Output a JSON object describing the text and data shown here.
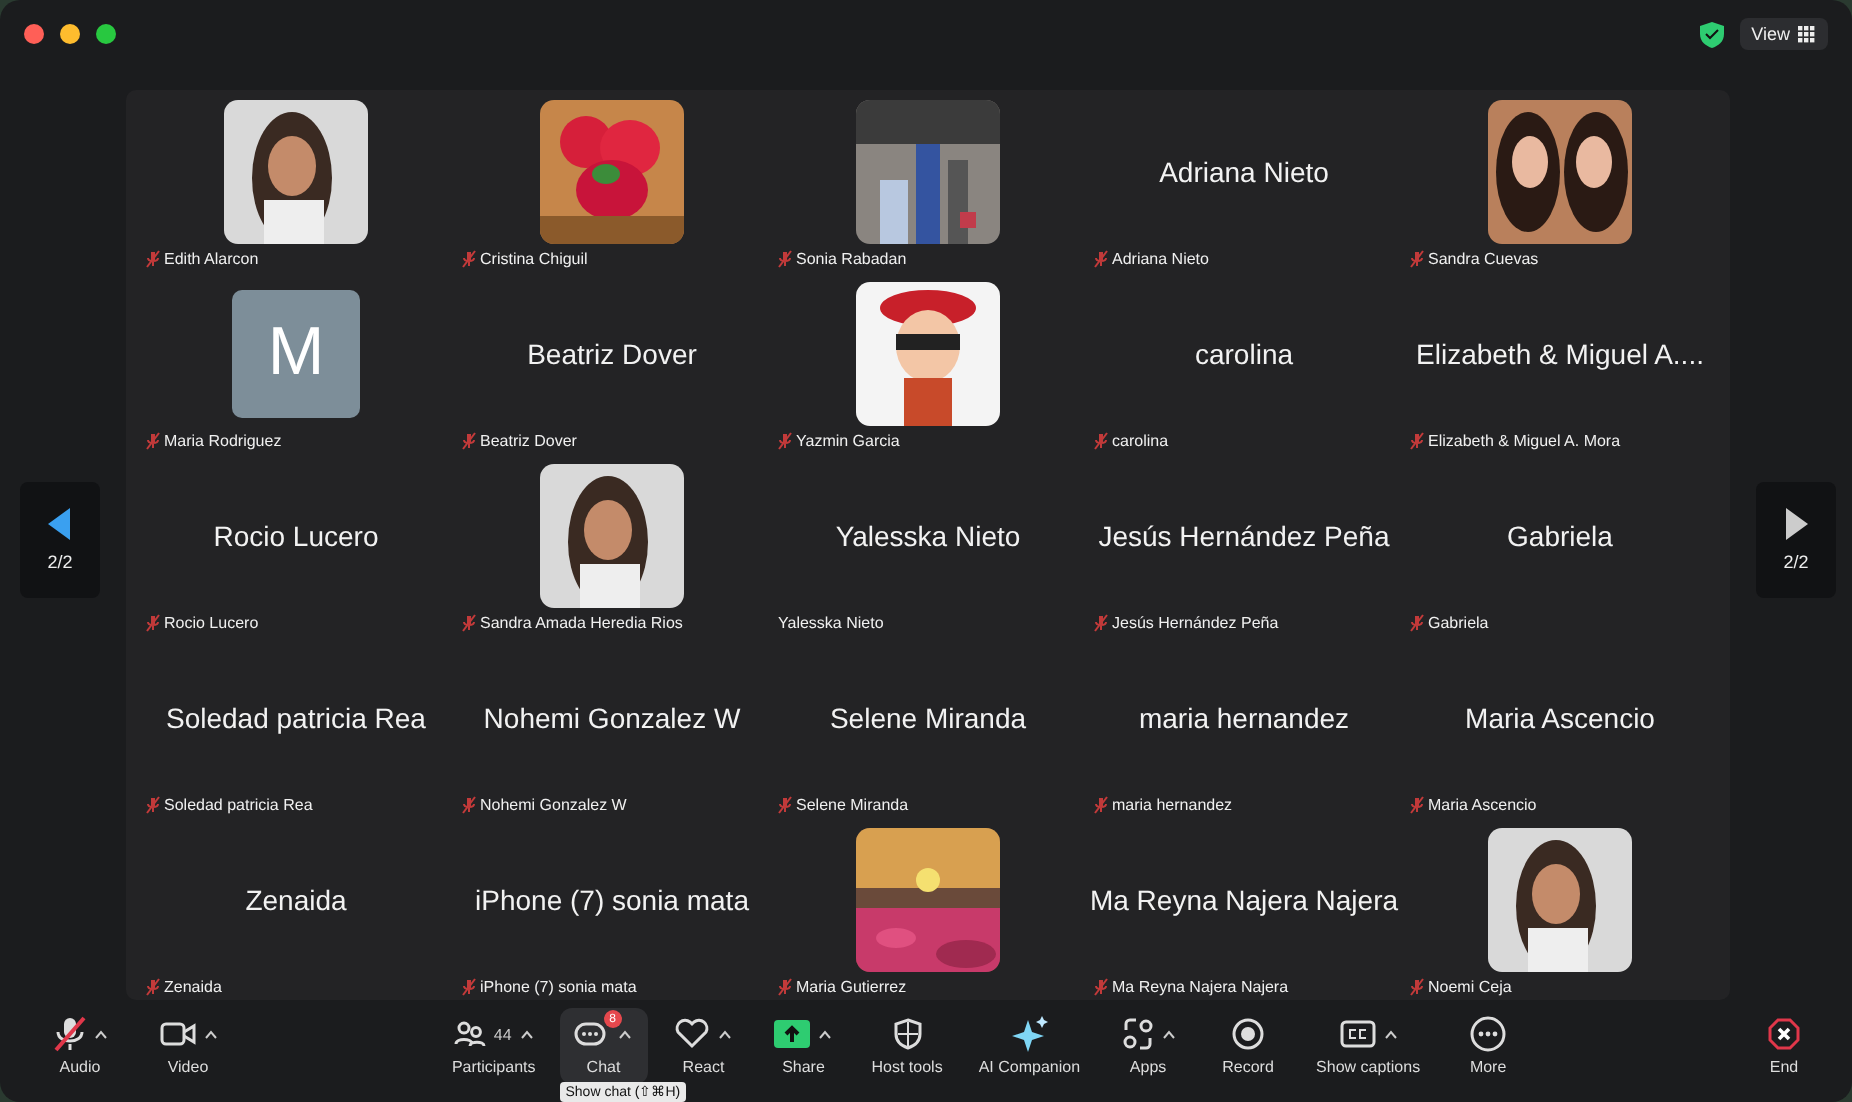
{
  "top_bar": {
    "view_label": "View"
  },
  "pager": {
    "previous_label": "2/2",
    "next_label": "2/2"
  },
  "tiles": [
    {
      "kind": "picture",
      "name": "Edith Alarcon",
      "muted": true
    },
    {
      "kind": "picture",
      "name": "Cristina Chiguil",
      "muted": true
    },
    {
      "kind": "picture",
      "name": "Sonia Rabadan",
      "muted": true
    },
    {
      "kind": "name",
      "display": "Adriana Nieto",
      "name": "Adriana Nieto",
      "muted": true
    },
    {
      "kind": "picture",
      "name": "Sandra Cuevas",
      "muted": true
    },
    {
      "kind": "initial",
      "display": "M",
      "name": "Maria Rodriguez",
      "muted": true
    },
    {
      "kind": "name",
      "display": "Beatriz Dover",
      "name": "Beatriz Dover",
      "muted": true
    },
    {
      "kind": "picture",
      "name": "Yazmin Garcia",
      "muted": true
    },
    {
      "kind": "name",
      "display": "carolina",
      "name": "carolina",
      "muted": true
    },
    {
      "kind": "name",
      "display": "Elizabeth & Miguel A....",
      "name": "Elizabeth & Miguel A.  Mora",
      "muted": true
    },
    {
      "kind": "name",
      "display": "Rocio Lucero",
      "name": "Rocio Lucero",
      "muted": true
    },
    {
      "kind": "picture",
      "name": "Sandra Amada Heredia Rios",
      "muted": true
    },
    {
      "kind": "name",
      "display": "Yalesska Nieto",
      "name": "Yalesska Nieto",
      "muted": false
    },
    {
      "kind": "name",
      "display": "Jesús Hernández Peña",
      "name": "Jesús Hernández Peña",
      "muted": true
    },
    {
      "kind": "name",
      "display": "Gabriela",
      "name": "Gabriela",
      "muted": true
    },
    {
      "kind": "name",
      "display": "Soledad patricia Rea",
      "name": "Soledad patricia Rea",
      "muted": true
    },
    {
      "kind": "name",
      "display": "Nohemi Gonzalez W",
      "name": "Nohemi Gonzalez W",
      "muted": true
    },
    {
      "kind": "name",
      "display": "Selene Miranda",
      "name": "Selene Miranda",
      "muted": true
    },
    {
      "kind": "name",
      "display": "maria hernandez",
      "name": "maria hernandez",
      "muted": true
    },
    {
      "kind": "name",
      "display": "Maria Ascencio",
      "name": "Maria Ascencio",
      "muted": true
    },
    {
      "kind": "name",
      "display": "Zenaida",
      "name": "Zenaida",
      "muted": true
    },
    {
      "kind": "name",
      "display": "iPhone (7) sonia mata",
      "name": "iPhone (7) sonia mata",
      "muted": true
    },
    {
      "kind": "picture",
      "name": "Maria Gutierrez",
      "muted": true
    },
    {
      "kind": "name",
      "display": "Ma Reyna Najera Najera",
      "name": "Ma Reyna Najera Najera",
      "muted": true
    },
    {
      "kind": "picture",
      "name": "Noemi Ceja",
      "muted": true
    }
  ],
  "toolbar_left": [
    {
      "kind": "audio",
      "label": "Audio",
      "caret": true,
      "muted": true
    },
    {
      "kind": "video",
      "label": "Video",
      "caret": true
    }
  ],
  "toolbar_center": [
    {
      "kind": "participants",
      "label": "Participants",
      "caret": true,
      "count": "44"
    },
    {
      "kind": "chat",
      "label": "Chat",
      "caret": true,
      "badge": "8",
      "selected": true,
      "tooltip": "Show chat (⇧⌘H)"
    },
    {
      "kind": "react",
      "label": "React",
      "caret": true
    },
    {
      "kind": "share",
      "label": "Share",
      "caret": true
    },
    {
      "kind": "host",
      "label": "Host tools",
      "caret": false
    },
    {
      "kind": "ai",
      "label": "AI Companion",
      "caret": false
    },
    {
      "kind": "apps",
      "label": "Apps",
      "caret": true
    },
    {
      "kind": "record",
      "label": "Record",
      "caret": false
    },
    {
      "kind": "captions",
      "label": "Show captions",
      "caret": true
    },
    {
      "kind": "more",
      "label": "More",
      "caret": false
    }
  ],
  "end_button": {
    "label": "End"
  }
}
